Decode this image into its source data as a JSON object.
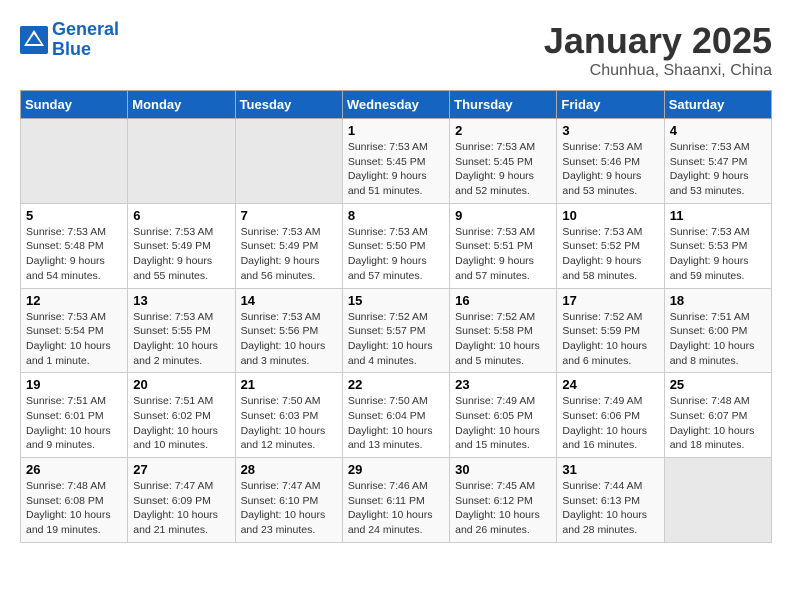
{
  "header": {
    "logo_line1": "General",
    "logo_line2": "Blue",
    "month_title": "January 2025",
    "location": "Chunhua, Shaanxi, China"
  },
  "weekdays": [
    "Sunday",
    "Monday",
    "Tuesday",
    "Wednesday",
    "Thursday",
    "Friday",
    "Saturday"
  ],
  "weeks": [
    [
      {
        "day": "",
        "info": ""
      },
      {
        "day": "",
        "info": ""
      },
      {
        "day": "",
        "info": ""
      },
      {
        "day": "1",
        "info": "Sunrise: 7:53 AM\nSunset: 5:45 PM\nDaylight: 9 hours and 51 minutes."
      },
      {
        "day": "2",
        "info": "Sunrise: 7:53 AM\nSunset: 5:45 PM\nDaylight: 9 hours and 52 minutes."
      },
      {
        "day": "3",
        "info": "Sunrise: 7:53 AM\nSunset: 5:46 PM\nDaylight: 9 hours and 53 minutes."
      },
      {
        "day": "4",
        "info": "Sunrise: 7:53 AM\nSunset: 5:47 PM\nDaylight: 9 hours and 53 minutes."
      }
    ],
    [
      {
        "day": "5",
        "info": "Sunrise: 7:53 AM\nSunset: 5:48 PM\nDaylight: 9 hours and 54 minutes."
      },
      {
        "day": "6",
        "info": "Sunrise: 7:53 AM\nSunset: 5:49 PM\nDaylight: 9 hours and 55 minutes."
      },
      {
        "day": "7",
        "info": "Sunrise: 7:53 AM\nSunset: 5:49 PM\nDaylight: 9 hours and 56 minutes."
      },
      {
        "day": "8",
        "info": "Sunrise: 7:53 AM\nSunset: 5:50 PM\nDaylight: 9 hours and 57 minutes."
      },
      {
        "day": "9",
        "info": "Sunrise: 7:53 AM\nSunset: 5:51 PM\nDaylight: 9 hours and 57 minutes."
      },
      {
        "day": "10",
        "info": "Sunrise: 7:53 AM\nSunset: 5:52 PM\nDaylight: 9 hours and 58 minutes."
      },
      {
        "day": "11",
        "info": "Sunrise: 7:53 AM\nSunset: 5:53 PM\nDaylight: 9 hours and 59 minutes."
      }
    ],
    [
      {
        "day": "12",
        "info": "Sunrise: 7:53 AM\nSunset: 5:54 PM\nDaylight: 10 hours and 1 minute."
      },
      {
        "day": "13",
        "info": "Sunrise: 7:53 AM\nSunset: 5:55 PM\nDaylight: 10 hours and 2 minutes."
      },
      {
        "day": "14",
        "info": "Sunrise: 7:53 AM\nSunset: 5:56 PM\nDaylight: 10 hours and 3 minutes."
      },
      {
        "day": "15",
        "info": "Sunrise: 7:52 AM\nSunset: 5:57 PM\nDaylight: 10 hours and 4 minutes."
      },
      {
        "day": "16",
        "info": "Sunrise: 7:52 AM\nSunset: 5:58 PM\nDaylight: 10 hours and 5 minutes."
      },
      {
        "day": "17",
        "info": "Sunrise: 7:52 AM\nSunset: 5:59 PM\nDaylight: 10 hours and 6 minutes."
      },
      {
        "day": "18",
        "info": "Sunrise: 7:51 AM\nSunset: 6:00 PM\nDaylight: 10 hours and 8 minutes."
      }
    ],
    [
      {
        "day": "19",
        "info": "Sunrise: 7:51 AM\nSunset: 6:01 PM\nDaylight: 10 hours and 9 minutes."
      },
      {
        "day": "20",
        "info": "Sunrise: 7:51 AM\nSunset: 6:02 PM\nDaylight: 10 hours and 10 minutes."
      },
      {
        "day": "21",
        "info": "Sunrise: 7:50 AM\nSunset: 6:03 PM\nDaylight: 10 hours and 12 minutes."
      },
      {
        "day": "22",
        "info": "Sunrise: 7:50 AM\nSunset: 6:04 PM\nDaylight: 10 hours and 13 minutes."
      },
      {
        "day": "23",
        "info": "Sunrise: 7:49 AM\nSunset: 6:05 PM\nDaylight: 10 hours and 15 minutes."
      },
      {
        "day": "24",
        "info": "Sunrise: 7:49 AM\nSunset: 6:06 PM\nDaylight: 10 hours and 16 minutes."
      },
      {
        "day": "25",
        "info": "Sunrise: 7:48 AM\nSunset: 6:07 PM\nDaylight: 10 hours and 18 minutes."
      }
    ],
    [
      {
        "day": "26",
        "info": "Sunrise: 7:48 AM\nSunset: 6:08 PM\nDaylight: 10 hours and 19 minutes."
      },
      {
        "day": "27",
        "info": "Sunrise: 7:47 AM\nSunset: 6:09 PM\nDaylight: 10 hours and 21 minutes."
      },
      {
        "day": "28",
        "info": "Sunrise: 7:47 AM\nSunset: 6:10 PM\nDaylight: 10 hours and 23 minutes."
      },
      {
        "day": "29",
        "info": "Sunrise: 7:46 AM\nSunset: 6:11 PM\nDaylight: 10 hours and 24 minutes."
      },
      {
        "day": "30",
        "info": "Sunrise: 7:45 AM\nSunset: 6:12 PM\nDaylight: 10 hours and 26 minutes."
      },
      {
        "day": "31",
        "info": "Sunrise: 7:44 AM\nSunset: 6:13 PM\nDaylight: 10 hours and 28 minutes."
      },
      {
        "day": "",
        "info": ""
      }
    ]
  ]
}
